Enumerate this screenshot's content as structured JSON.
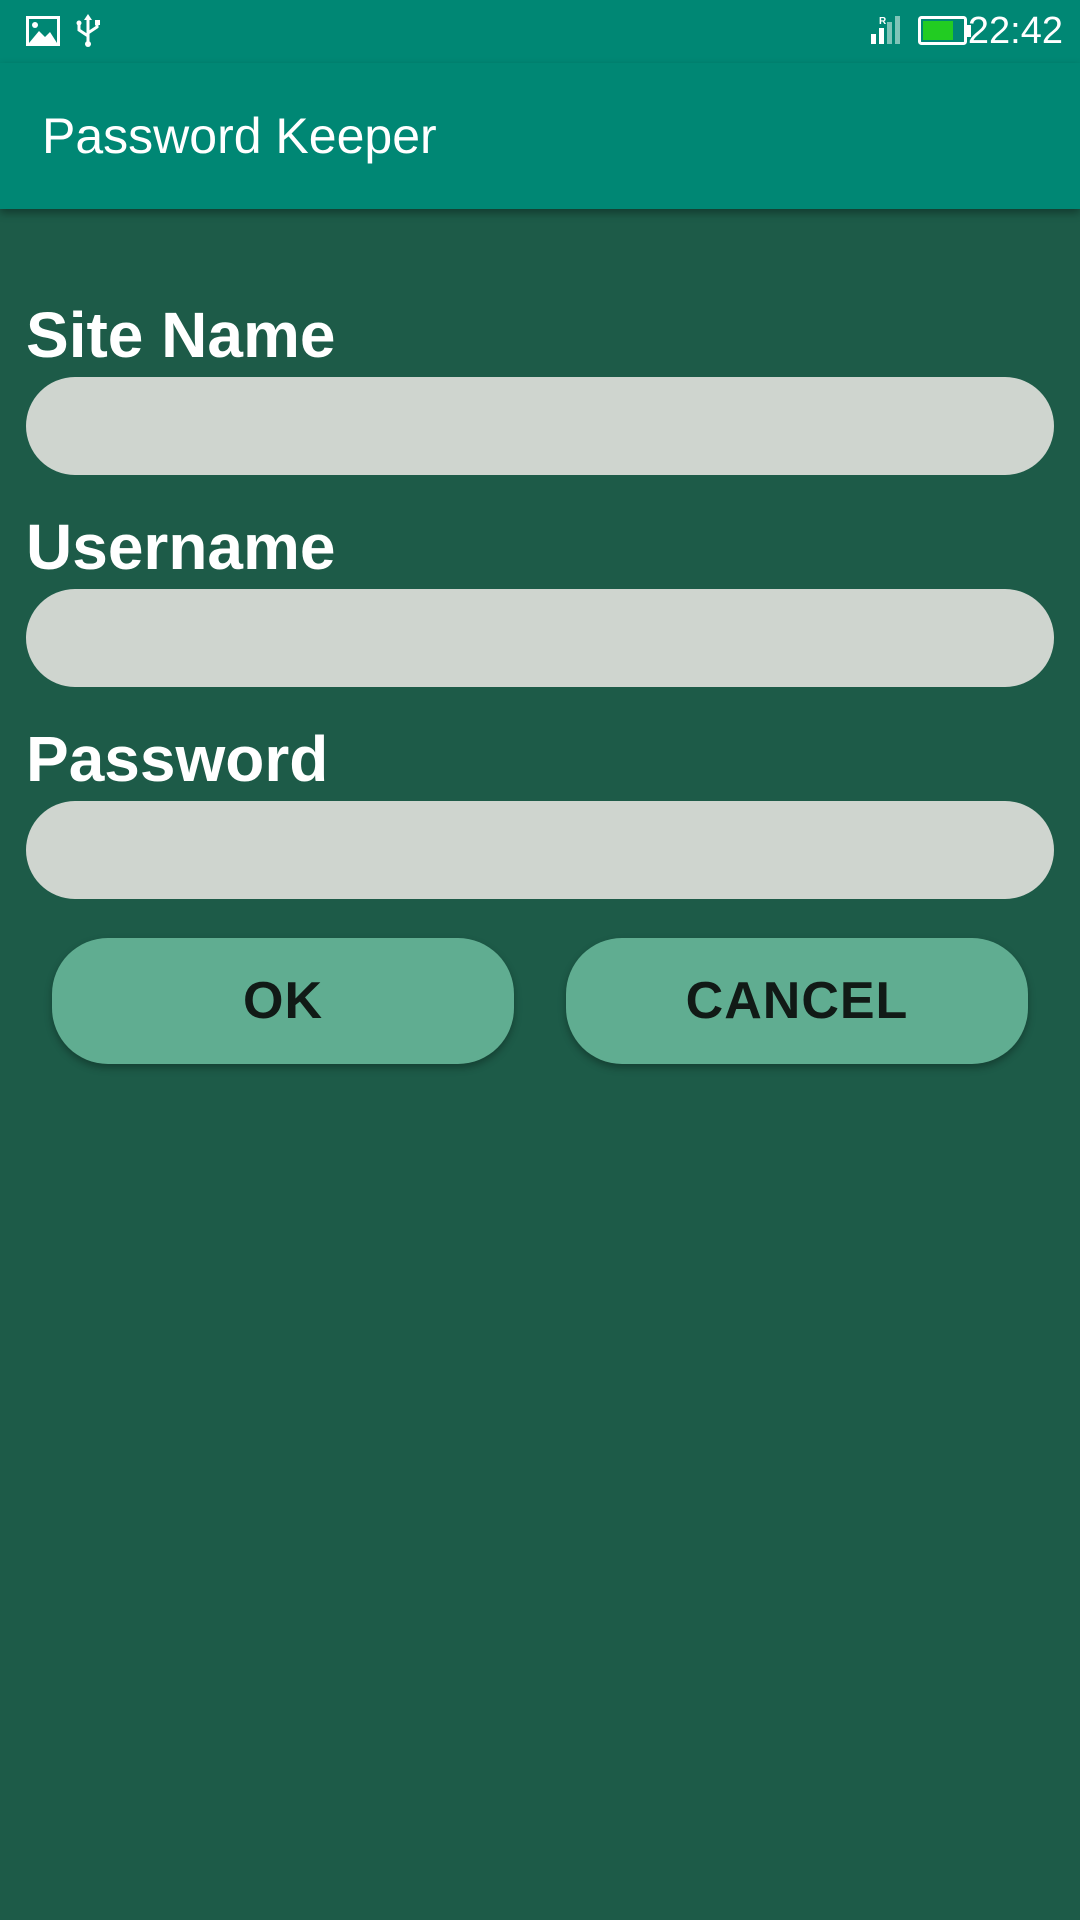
{
  "status_bar": {
    "time": "22:42",
    "left_icons": [
      "image-icon",
      "usb-icon"
    ],
    "right_icons": [
      "signal-icon",
      "battery-icon"
    ],
    "signal_roaming_mark": "R",
    "battery_color": "#22cc22"
  },
  "app_bar": {
    "title": "Password Keeper",
    "background_color": "#008774"
  },
  "form": {
    "site_name": {
      "label": "Site Name",
      "value": "",
      "placeholder": ""
    },
    "username": {
      "label": "Username",
      "value": "",
      "placeholder": ""
    },
    "password": {
      "label": "Password",
      "value": "",
      "placeholder": ""
    }
  },
  "buttons": {
    "ok_label": "OK",
    "cancel_label": "CANCEL"
  },
  "colors": {
    "background": "#1d5b48",
    "input_fill": "#cfd5cf",
    "button_fill": "#60ad91"
  }
}
